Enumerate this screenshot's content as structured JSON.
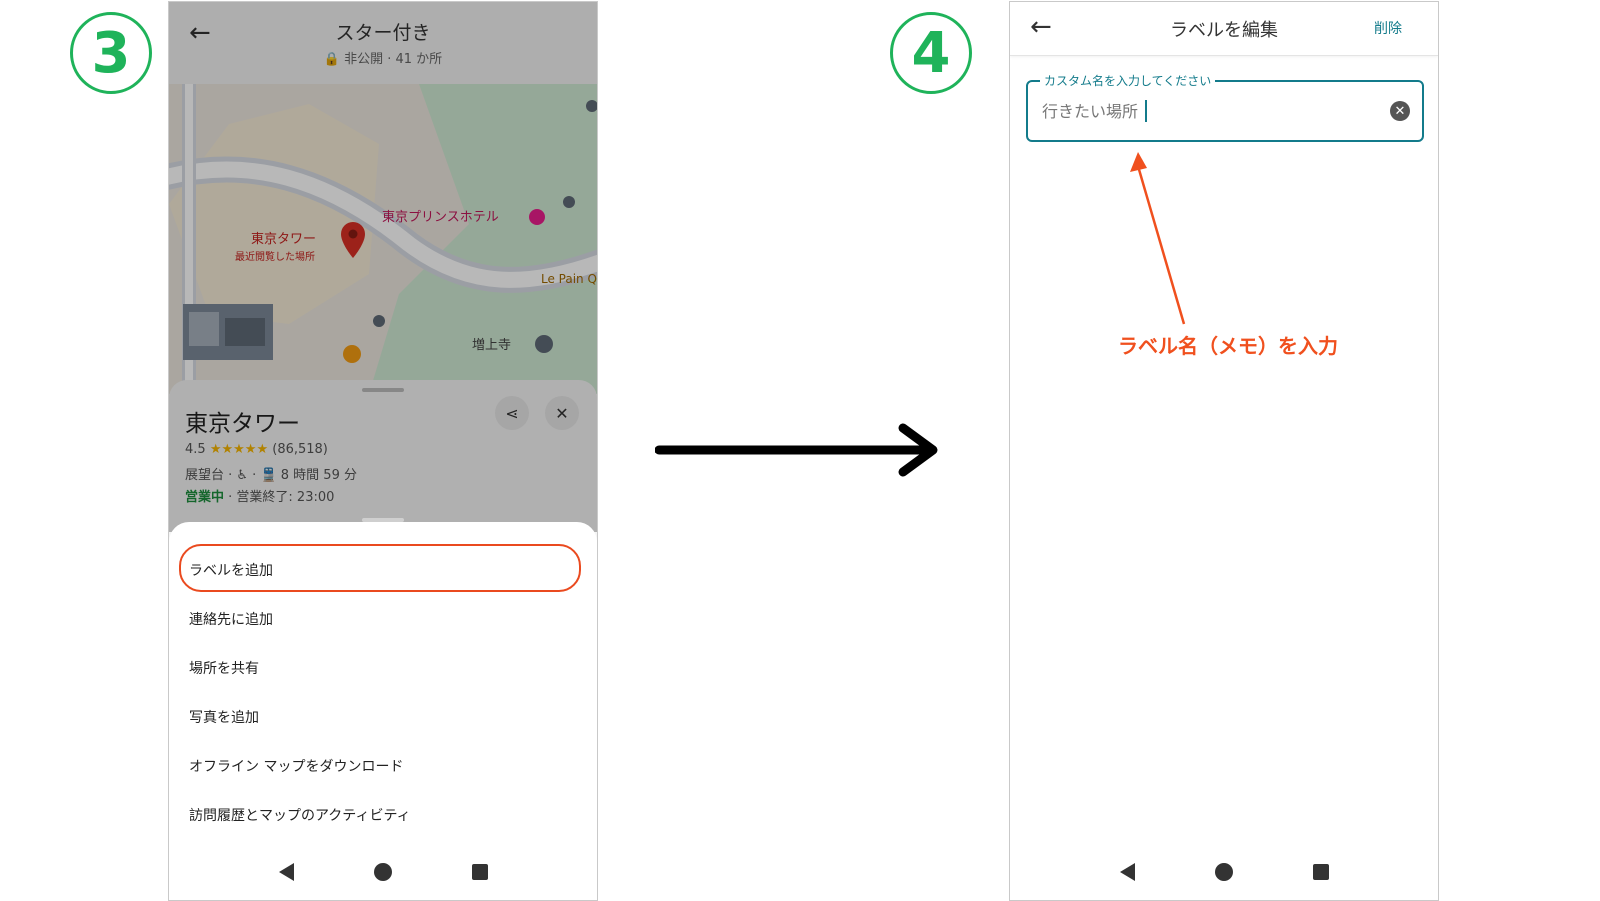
{
  "badges": {
    "left": "3",
    "right": "4"
  },
  "colors": {
    "badge_green": "#1fb35a",
    "highlight": "#ea4a1f",
    "accent_teal": "#137b8b",
    "annotation": "#f0501e"
  },
  "screen3": {
    "header": {
      "back_icon": "arrow-left-icon",
      "title": "スター付き",
      "subtitle": "🔒 非公開 · 41 か所"
    },
    "map": {
      "place_label": "東京タワー",
      "place_sublabel": "最近閲覧した場所",
      "hotel_label": "東京プリンスホテル",
      "temple_label": "増上寺",
      "bakery_label": "Le Pain Q"
    },
    "card": {
      "name": "東京タワー",
      "rating_value": "4.5",
      "stars": "★★★★★",
      "review_count": "(86,518)",
      "meta": "展望台 · ♿ · 🚆 8 時間 59 分",
      "status_open": "営業中",
      "status_close": " · 営業終了: 23:00"
    },
    "menu": [
      {
        "label": "ラベルを追加"
      },
      {
        "label": "連絡先に追加"
      },
      {
        "label": "場所を共有"
      },
      {
        "label": "写真を追加"
      },
      {
        "label": "オフライン マップをダウンロード"
      },
      {
        "label": "訪問履歴とマップのアクティビティ"
      }
    ]
  },
  "screen4": {
    "header": {
      "back_icon": "arrow-left-icon",
      "title": "ラベルを編集",
      "delete_label": "削除"
    },
    "field": {
      "label": "カスタム名を入力してください",
      "value": "行きたい場所"
    },
    "annotation": "ラベル名（メモ）を入力"
  }
}
